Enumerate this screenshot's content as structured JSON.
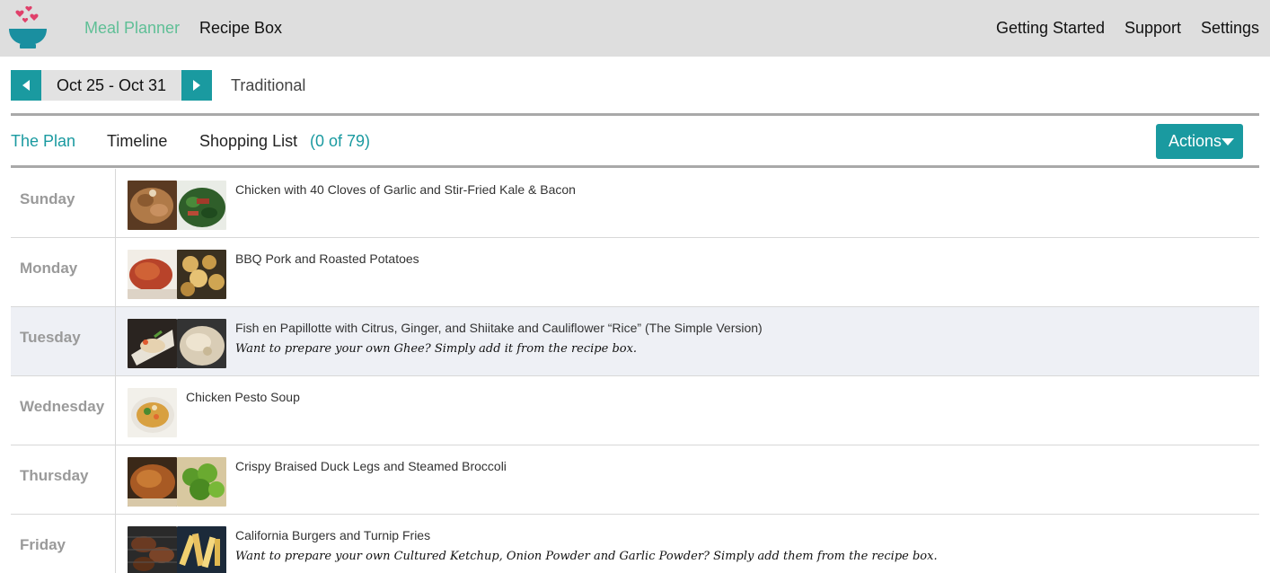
{
  "nav": {
    "meal_planner": "Meal Planner",
    "recipe_box": "Recipe Box",
    "getting_started": "Getting Started",
    "support": "Support",
    "settings": "Settings"
  },
  "week": {
    "label": "Oct 25 - Oct 31",
    "plan_style": "Traditional"
  },
  "tabs": {
    "the_plan": "The Plan",
    "timeline": "Timeline",
    "shopping_list": "Shopping List",
    "shopping_count": "(0 of 79)"
  },
  "actions_label": "Actions",
  "days": [
    {
      "day": "Sunday",
      "meal": "Chicken with 40 Cloves of Garlic and Stir-Fried Kale & Bacon",
      "note": ""
    },
    {
      "day": "Monday",
      "meal": "BBQ Pork and Roasted Potatoes",
      "note": ""
    },
    {
      "day": "Tuesday",
      "meal": "Fish en Papillotte with Citrus, Ginger, and Shiitake and Cauliflower “Rice” (The Simple Version)",
      "note": "Want to prepare your own Ghee? Simply add it from the recipe box."
    },
    {
      "day": "Wednesday",
      "meal": "Chicken Pesto Soup",
      "note": ""
    },
    {
      "day": "Thursday",
      "meal": "Crispy Braised Duck Legs and Steamed Broccoli",
      "note": ""
    },
    {
      "day": "Friday",
      "meal": "California Burgers and Turnip Fries",
      "note": "Want to prepare your own Cultured Ketchup, Onion Powder and Garlic Powder? Simply add them from the recipe box."
    }
  ],
  "colors": {
    "accent": "#1a9aa0",
    "active_nav": "#5fbf96",
    "heart": "#e0406a",
    "bowl": "#1a8fa0"
  }
}
